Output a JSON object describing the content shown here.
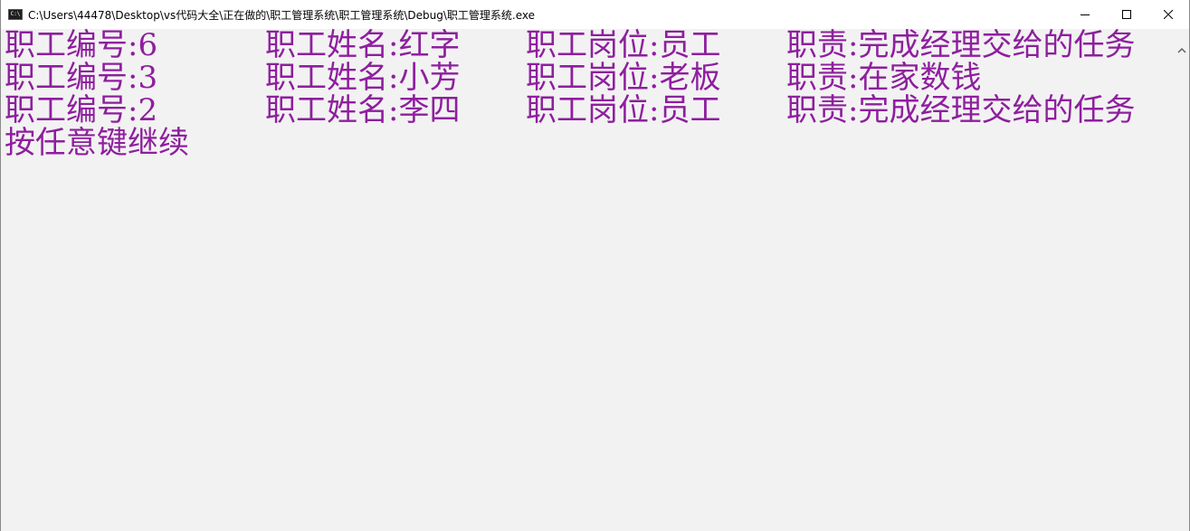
{
  "window": {
    "icon_text": "C:\\",
    "title": "C:\\Users\\44478\\Desktop\\vs代码大全\\正在做的\\职工管理系统\\职工管理系统\\Debug\\职工管理系统.exe"
  },
  "colors": {
    "console_text": "#8e1f9e",
    "console_bg": "#f2f2f2"
  },
  "console": {
    "rows": [
      {
        "id": "职工编号:6",
        "name": "职工姓名:红字",
        "post": "职工岗位:员工",
        "duty": "职责:完成经理交给的任务"
      },
      {
        "id": "职工编号:3",
        "name": "职工姓名:小芳",
        "post": "职工岗位:老板",
        "duty": "职责:在家数钱"
      },
      {
        "id": "职工编号:2",
        "name": "职工姓名:李四",
        "post": "职工岗位:员工",
        "duty": "职责:完成经理交给的任务"
      }
    ],
    "prompt": "按任意键继续"
  }
}
